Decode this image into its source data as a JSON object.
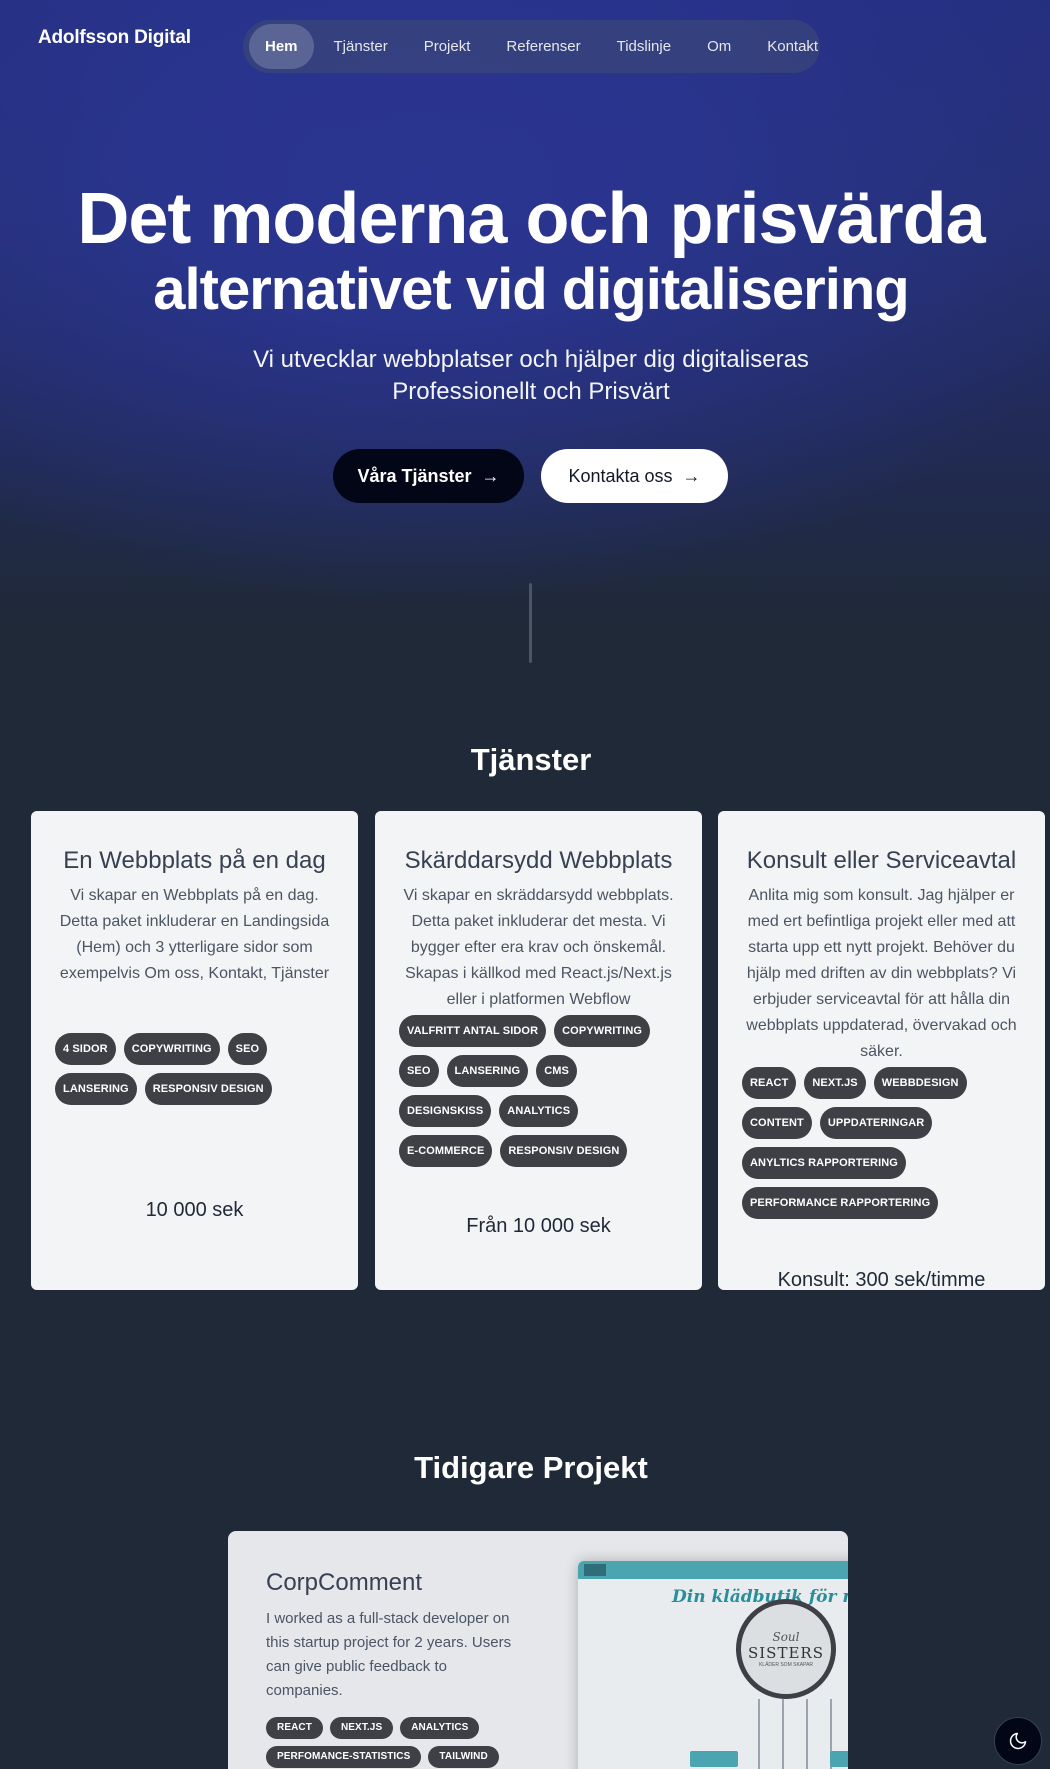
{
  "brand": "Adolfsson Digital",
  "nav": {
    "items": [
      {
        "label": "Hem",
        "active": true
      },
      {
        "label": "Tjänster"
      },
      {
        "label": "Projekt"
      },
      {
        "label": "Referenser"
      },
      {
        "label": "Tidslinje"
      },
      {
        "label": "Om"
      },
      {
        "label": "Kontakt"
      }
    ]
  },
  "hero": {
    "title_line1": "Det moderna och prisvärda",
    "title_line2": "alternativet vid digitalisering",
    "subtitle_line1": "Vi utvecklar webbplatser och hjälper dig digitaliseras",
    "subtitle_line2": "Professionellt och Prisvärt",
    "primary_button": "Våra Tjänster",
    "secondary_button": "Kontakta oss"
  },
  "services": {
    "title": "Tjänster",
    "cards": [
      {
        "title": "En Webbplats på en dag",
        "description": "Vi skapar en Webbplats på en dag. Detta paket inkluderar en Landingsida (Hem) och 3 ytterligare sidor som exempelvis Om oss, Kontakt, Tjänster",
        "tags": [
          "4 sidor",
          "copywriting",
          "SEO",
          "Lansering",
          "Responsiv design"
        ],
        "price": "10 000 sek"
      },
      {
        "title": "Skärddarsydd Webbplats",
        "description": "Vi skapar en skräddarsydd webbplats. Detta paket inkluderar det mesta. Vi bygger efter era krav och önskemål. Skapas i källkod med React.js/Next.js eller i platformen Webflow",
        "tags": [
          "Valfritt antal sidor",
          "copywriting",
          "SEO",
          "Lansering",
          "CMS",
          "Designskiss",
          "Analytics",
          "E-commerce",
          "Responsiv design"
        ],
        "price": "Från 10 000 sek"
      },
      {
        "title": "Konsult eller Serviceavtal",
        "description": "Anlita mig som konsult. Jag hjälper er med ert befintliga projekt eller med att starta upp ett nytt projekt. Behöver du hjälp med driften av din webbplats? Vi erbjuder serviceavtal för att hålla din webbplats uppdaterad, övervakad och säker.",
        "tags": [
          "React",
          "Next.js",
          "Webbdesign",
          "Content",
          "Uppdateringar",
          "Anyltics rapportering",
          "Performance rapportering"
        ],
        "price": "Konsult: 300 sek/timme"
      }
    ]
  },
  "projects": {
    "title": "Tidigare Projekt",
    "items": [
      {
        "title": "CorpComment",
        "description": "I worked as a full-stack developer on this startup project for 2 years. Users can give public feedback to companies.",
        "tags": [
          "React",
          "Next.js",
          "Analytics",
          "Perfomance-statistics",
          "Tailwind"
        ],
        "screenshot": {
          "headline": "Din klädbutik för mode och stil",
          "logo_top": "Soul",
          "logo_main": "SISTERS",
          "logo_sub": "KLÄDER SOM SKAPAR"
        }
      }
    ]
  },
  "theme_toggle_icon": "moon-icon"
}
